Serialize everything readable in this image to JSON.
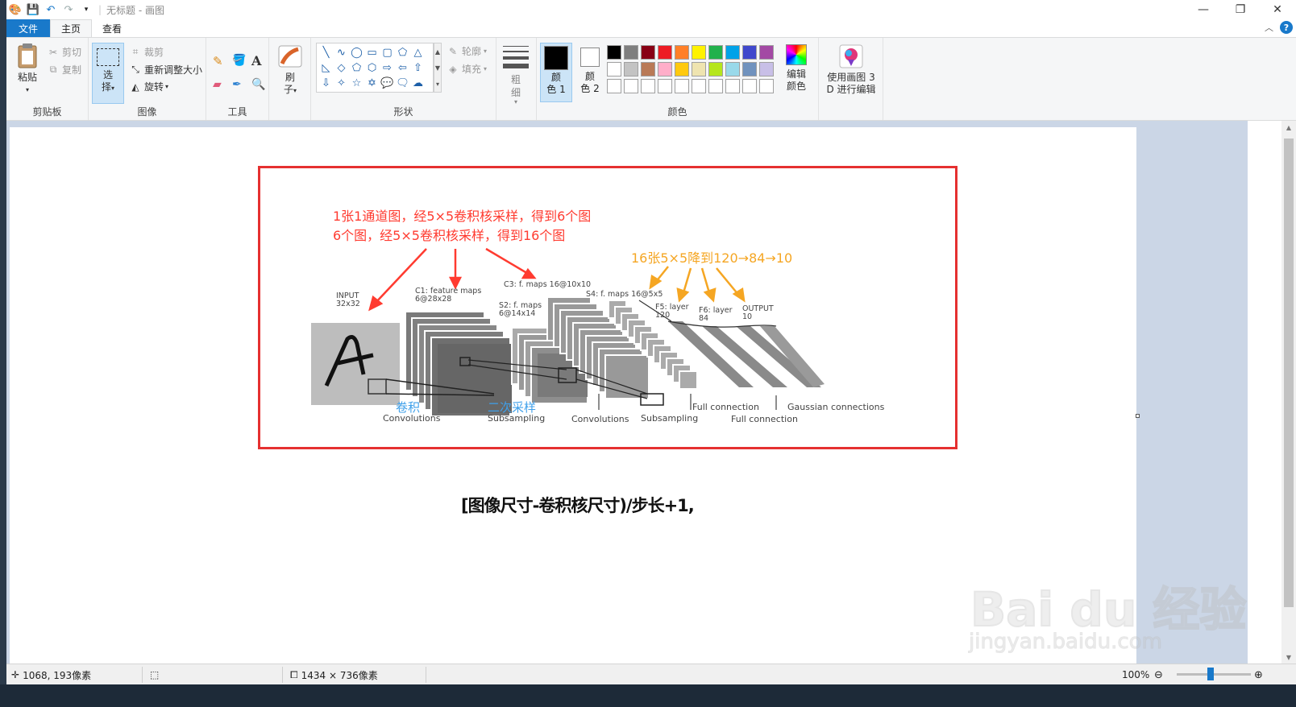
{
  "window": {
    "title": "无标题 - 画图",
    "controls": {
      "minimize": "—",
      "maximize": "❐",
      "close": "✕"
    }
  },
  "menu": {
    "file": "文件",
    "tabs": [
      "主页",
      "查看"
    ]
  },
  "ribbon": {
    "clipboard": {
      "label": "剪贴板",
      "paste": "粘贴",
      "cut": "剪切",
      "copy": "复制"
    },
    "image": {
      "label": "图像",
      "select_top": "选",
      "select_bottom": "择",
      "crop": "裁剪",
      "resize": "重新调整大小",
      "rotate": "旋转"
    },
    "tools": {
      "label": "工具"
    },
    "brush": {
      "top": "刷",
      "bottom": "子"
    },
    "shapes": {
      "label": "形状",
      "outline": "轮廓",
      "fill": "填充"
    },
    "size": {
      "top": "粗",
      "bottom": "细"
    },
    "colors": {
      "label": "颜色",
      "color1_top": "颜",
      "color1_bottom": "色 1",
      "color2_top": "颜",
      "color2_bottom": "色 2",
      "edit_top": "编辑",
      "edit_bottom": "颜色",
      "color1": "#000000",
      "color2": "#ffffff",
      "palette": [
        "#000000",
        "#7f7f7f",
        "#880015",
        "#ed1c24",
        "#ff7f27",
        "#fff200",
        "#22b14c",
        "#00a2e8",
        "#3f48cc",
        "#a349a4",
        "#ffffff",
        "#c3c3c3",
        "#b97a57",
        "#ffaec9",
        "#ffc90e",
        "#efe4b0",
        "#b5e61d",
        "#99d9ea",
        "#7092be",
        "#c8bfe7",
        "#ffffff",
        "#ffffff",
        "#ffffff",
        "#ffffff",
        "#ffffff",
        "#ffffff",
        "#ffffff",
        "#ffffff",
        "#ffffff",
        "#ffffff"
      ]
    },
    "paint3d": {
      "line1": "使用画图 3",
      "line2": "D 进行编辑"
    }
  },
  "diagram": {
    "red_line1": "1张1通道图，经5×5卷积核采样，得到6个图",
    "red_line2": "6个图，经5×5卷积核采样，得到16个图",
    "orange_line": "16张5×5降到120→84→10",
    "blue_conv": "卷积",
    "blue_sub": "二次采样",
    "input": "INPUT",
    "input_size": "32x32",
    "c1": "C1: feature maps",
    "c1_size": "6@28x28",
    "s2": "S2: f. maps",
    "s2_size": "6@14x14",
    "c3": "C3: f. maps 16@10x10",
    "s4": "S4: f. maps 16@5x5",
    "f5": "F5: layer",
    "f5_n": "120",
    "f6": "F6: layer",
    "f6_n": "84",
    "output": "OUTPUT",
    "output_n": "10",
    "b_conv1": "Convolutions",
    "b_sub1": "Subsampling",
    "b_conv2": "Convolutions",
    "b_sub2": "Subsampling",
    "b_full1": "Full connection",
    "b_full2": "Full connection",
    "b_gauss": "Gaussian connections"
  },
  "formula": "[图像尺寸-卷积核尺寸)/步长+1,",
  "watermark": {
    "brand": "Bai du 经验",
    "url": "jingyan.baidu.com"
  },
  "status": {
    "cursor": "1068, 193像素",
    "image_size": "1434 × 736像素",
    "zoom": "100%"
  }
}
